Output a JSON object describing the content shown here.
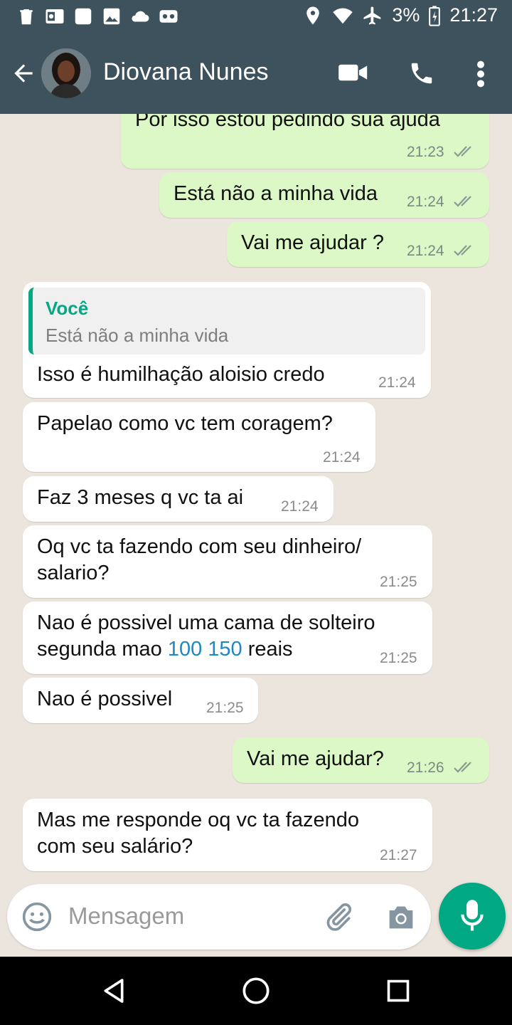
{
  "status_bar": {
    "battery": "3%",
    "time": "21:27",
    "icons": [
      "trash-icon",
      "outlook-icon",
      "app-icon",
      "gallery-icon",
      "cloud-icon",
      "voicemail-icon",
      "location-icon",
      "wifi-icon",
      "airplane-icon",
      "battery-icon"
    ]
  },
  "header": {
    "contact_name": "Diovana Nunes",
    "icons": [
      "back-arrow-icon",
      "video-call-icon",
      "phone-icon",
      "more-options-icon"
    ]
  },
  "messages": [
    {
      "dir": "out",
      "text": "Por isso estou pedindo sua ajuda",
      "time": "21:23",
      "status": "read"
    },
    {
      "dir": "out",
      "text": "Está não a minha vida",
      "time": "21:24",
      "status": "read"
    },
    {
      "dir": "out",
      "text": "Vai me ajudar ?",
      "time": "21:24",
      "status": "read"
    },
    {
      "dir": "in",
      "quote": {
        "author": "Você",
        "text": "Está não a minha vida"
      },
      "text": "Isso é humilhação aloisio credo",
      "time": "21:24"
    },
    {
      "dir": "in",
      "text": "Papelao como vc tem coragem?",
      "time": "21:24"
    },
    {
      "dir": "in",
      "text": "Faz 3 meses q vc ta ai",
      "time": "21:24"
    },
    {
      "dir": "in",
      "text_line1": "Oq vc ta fazendo com seu dinheiro/",
      "text_line2": "salario?",
      "time": "21:25"
    },
    {
      "dir": "in",
      "text_line1": "Nao é possivel uma cama de solteiro",
      "text_line2_pre": "segunda mao ",
      "text_line2_link": "100 150",
      "text_line2_post": " reais",
      "time": "21:25"
    },
    {
      "dir": "in",
      "text": "Nao é possivel",
      "time": "21:25"
    },
    {
      "dir": "out",
      "text": "Vai me ajudar?",
      "time": "21:26",
      "status": "read"
    },
    {
      "dir": "in",
      "text_line1": "Mas me responde oq vc ta fazendo",
      "text_line2": "com seu salário?",
      "time": "21:27"
    }
  ],
  "composer": {
    "placeholder": "Mensagem",
    "icons": [
      "emoji-icon",
      "attach-icon",
      "camera-icon",
      "mic-icon"
    ]
  },
  "colors": {
    "header": "#3d525c",
    "chat_bg": "#ece5dd",
    "outgoing": "#dcf8c6",
    "incoming": "#ffffff",
    "accent": "#00a884",
    "read_ticks": "#8a9a93",
    "link": "#1e88c4"
  },
  "nav_bar": {
    "icons": [
      "nav-back-icon",
      "nav-home-icon",
      "nav-recent-icon"
    ]
  }
}
